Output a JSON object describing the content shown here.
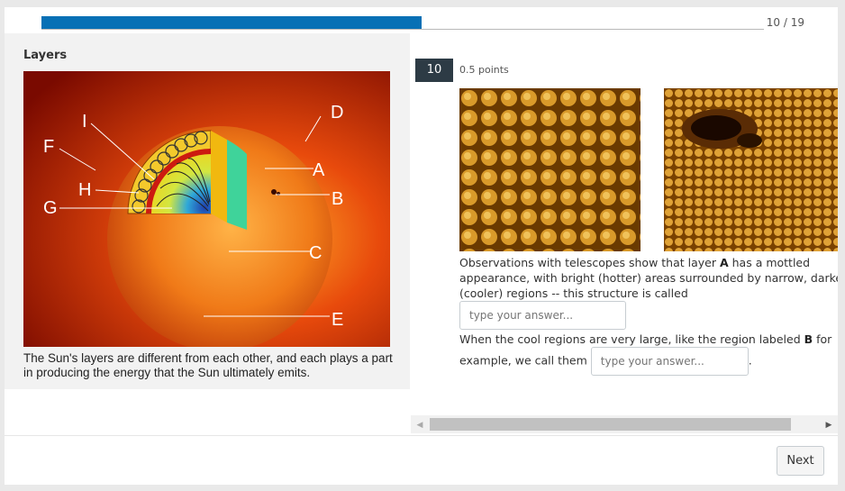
{
  "progress": {
    "text": "10 / 19",
    "fraction": 0.526
  },
  "left_panel": {
    "title": "Layers",
    "figure_labels": {
      "A": "A",
      "B": "B",
      "C": "C",
      "D": "D",
      "E": "E",
      "F": "F",
      "G": "G",
      "H": "H",
      "I": "I"
    },
    "caption": "The Sun's layers are different from each other, and each plays a part in producing the energy that the Sun ultimately emits."
  },
  "question": {
    "number": "10",
    "points": "0.5 points",
    "q1_before_a": "Observations with telescopes show that layer ",
    "q1_bold": "A",
    "q1_after": " has a mottled appearance, with bright (hotter) areas surrounded by narrow, darker (cooler) regions -- this structure is called",
    "q1_placeholder": "type your answer...",
    "q2_before": "When the cool regions are very large, like the region labeled ",
    "q2_bold": "B",
    "q2_after": " for example, we call them",
    "q2_placeholder": "type your answer...",
    "q2_end": "."
  },
  "footer": {
    "next_label": "Next"
  },
  "colors": {
    "progress": "#0770b5",
    "question_badge": "#2d3b45"
  }
}
